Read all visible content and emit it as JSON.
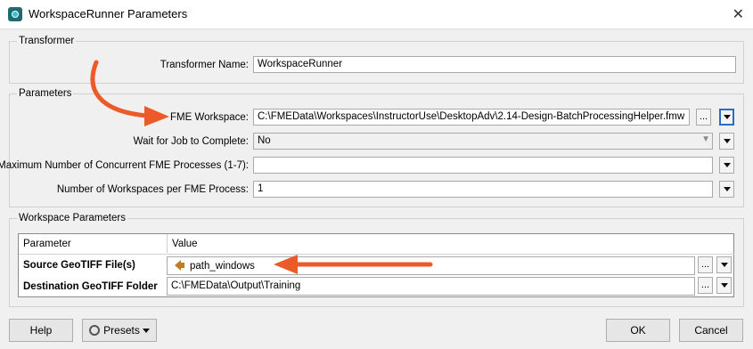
{
  "window": {
    "title": "WorkspaceRunner Parameters"
  },
  "transformer": {
    "group_label": "Transformer",
    "name_label": "Transformer Name:",
    "name_value": "WorkspaceRunner"
  },
  "parameters": {
    "group_label": "Parameters",
    "fme_workspace_label": "FME Workspace:",
    "fme_workspace_value": "C:\\FMEData\\Workspaces\\InstructorUse\\DesktopAdv\\2.14-Design-BatchProcessingHelper.fmw",
    "browse_label": "...",
    "wait_label": "Wait for Job to Complete:",
    "wait_value": "No",
    "max_processes_label": "Maximum Number of Concurrent FME Processes (1-7):",
    "max_processes_value": "",
    "workspaces_per_process_label": "Number of Workspaces per FME Process:",
    "workspaces_per_process_value": "1"
  },
  "workspace_parameters": {
    "group_label": "Workspace Parameters",
    "columns": [
      "Parameter",
      "Value"
    ],
    "rows": [
      {
        "parameter": "Source GeoTIFF File(s)",
        "value": "path_windows",
        "icon": "attribute-icon"
      },
      {
        "parameter": "Destination GeoTIFF Folder",
        "value": "C:\\FMEData\\Output\\Training"
      }
    ]
  },
  "footer": {
    "help": "Help",
    "presets": "Presets",
    "ok": "OK",
    "cancel": "Cancel"
  },
  "annotation_color": "#ec5a2a"
}
